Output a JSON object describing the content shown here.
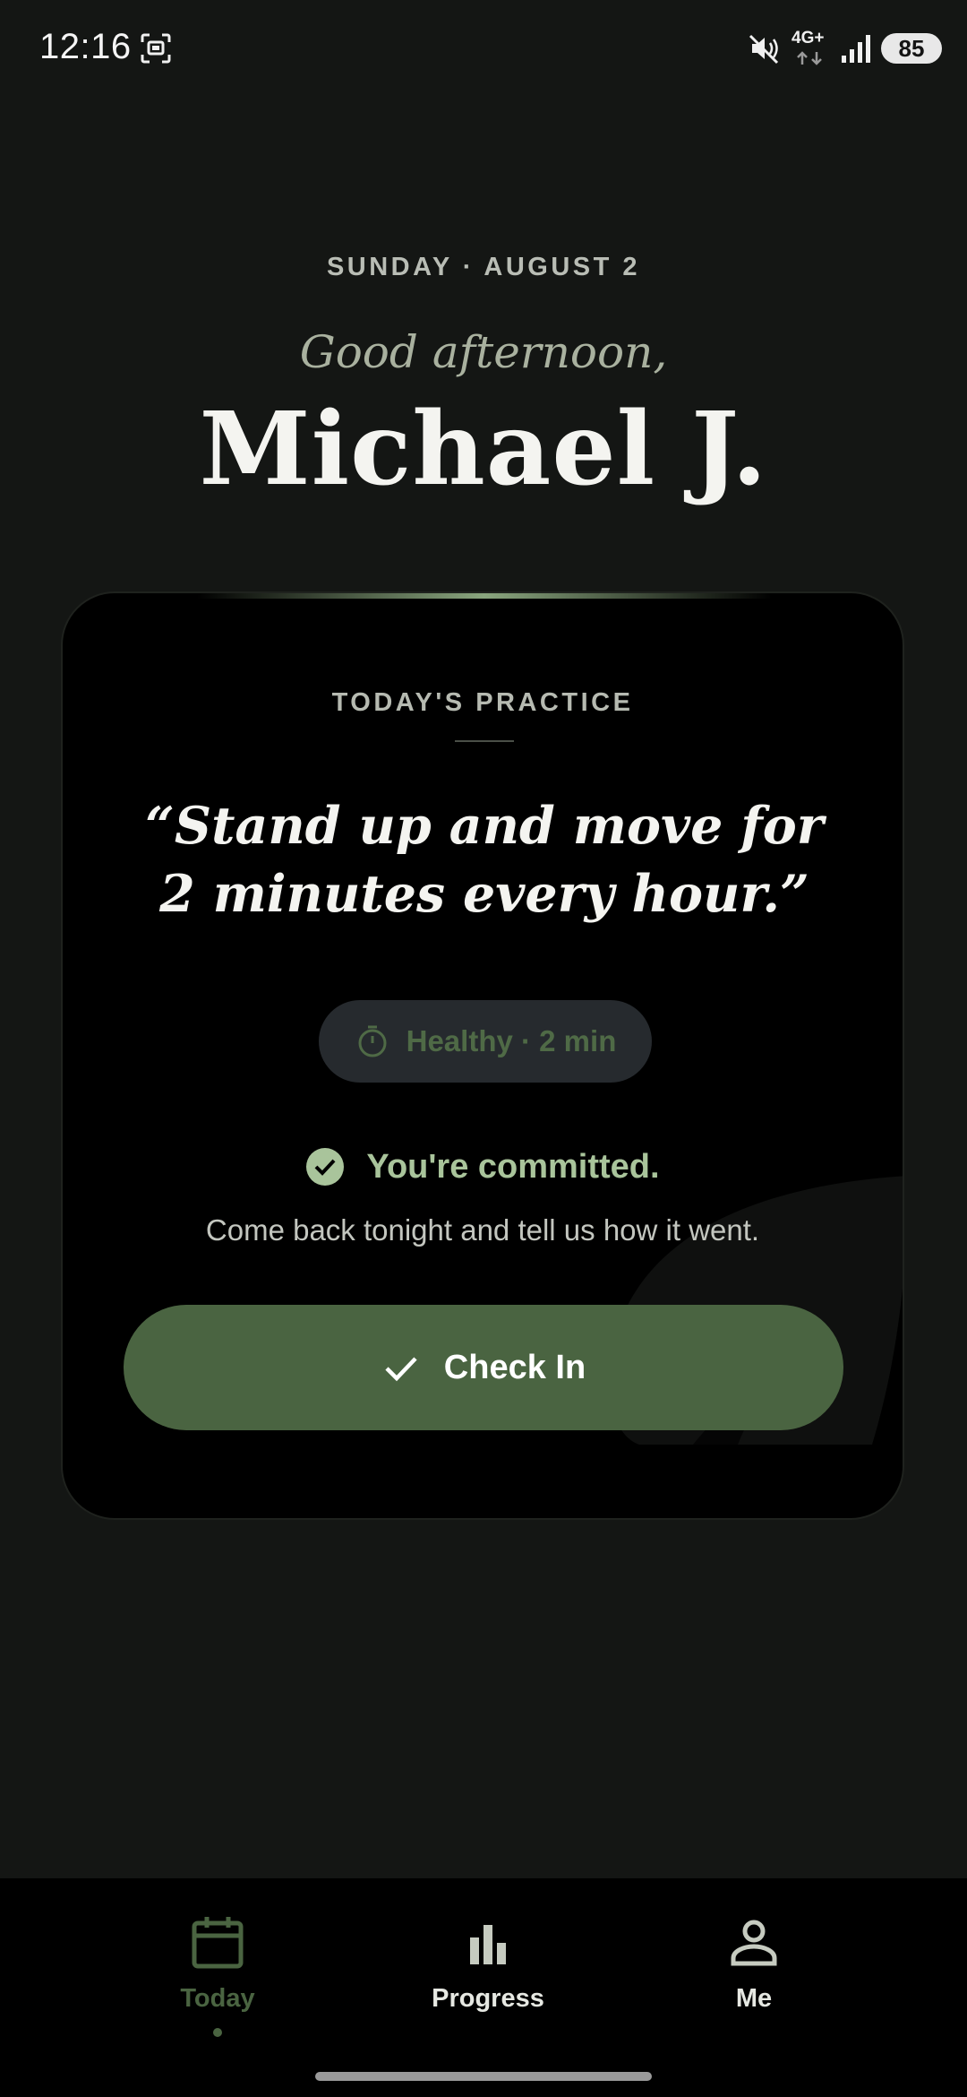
{
  "status_bar": {
    "time": "12:16",
    "network": "4G+",
    "battery": "85"
  },
  "header": {
    "date": "SUNDAY · AUGUST 2",
    "greeting": "Good afternoon,",
    "name": "Michael J."
  },
  "practice_card": {
    "title": "TODAY'S PRACTICE",
    "quote": "“Stand up and move for 2 minutes every hour.”",
    "tag": "Healthy · 2 min",
    "committed_text": "You're committed.",
    "subtext": "Come back tonight and tell us how it went.",
    "checkin_label": "Check In"
  },
  "bottom_nav": {
    "items": [
      {
        "label": "Today",
        "icon": "calendar-icon",
        "active": true
      },
      {
        "label": "Progress",
        "icon": "bar-chart-icon",
        "active": false
      },
      {
        "label": "Me",
        "icon": "person-icon",
        "active": false
      }
    ]
  },
  "colors": {
    "background": "#141614",
    "card": "#000000",
    "accent_green": "#4a6441",
    "committed_green": "#a9c49b",
    "pill_bg": "#262a2e",
    "muted_text": "#b9bdb5"
  }
}
